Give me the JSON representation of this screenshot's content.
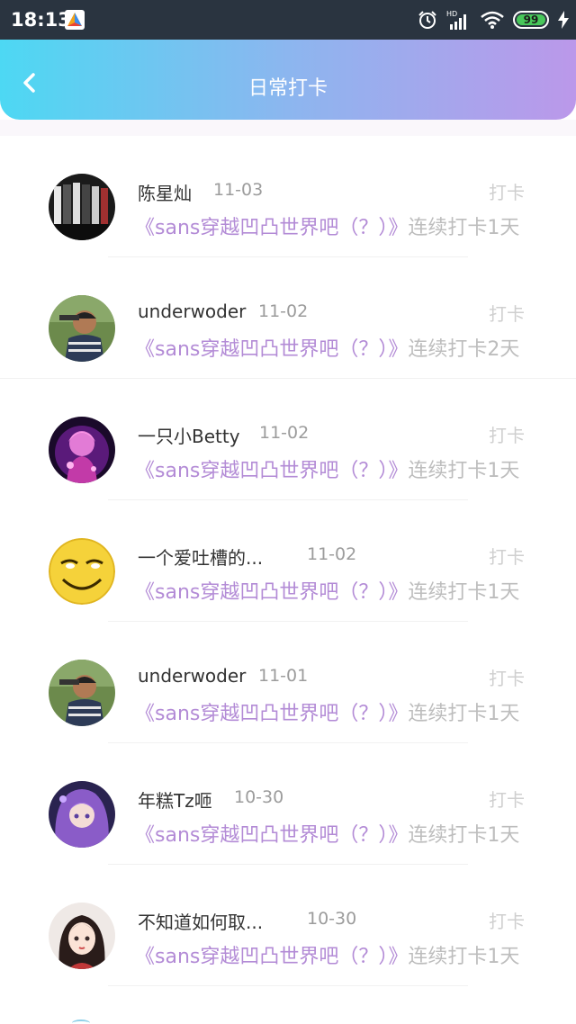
{
  "status_bar": {
    "time": "18:13",
    "network": "HD",
    "battery": "99"
  },
  "header": {
    "title": "日常打卡",
    "back_icon": "chevron-left-icon"
  },
  "colors": {
    "topic": "#b38bd6",
    "header_start": "#4dd8f3",
    "header_end": "#bb98ea"
  },
  "checkins": [
    {
      "name": "陈星灿",
      "date": "11-03",
      "action": "打卡",
      "topic": "《sans穿越凹凸世界吧（？）》",
      "streak": "连续打卡1天"
    },
    {
      "name": "underwoder",
      "date": "11-02",
      "action": "打卡",
      "topic": "《sans穿越凹凸世界吧（？）》",
      "streak": "连续打卡2天"
    },
    {
      "name": "一只小Betty",
      "date": "11-02",
      "action": "打卡",
      "topic": "《sans穿越凹凸世界吧（？）》",
      "streak": "连续打卡1天"
    },
    {
      "name": "一个爱吐槽的...",
      "date": "11-02",
      "action": "打卡",
      "topic": "《sans穿越凹凸世界吧（？）》",
      "streak": "连续打卡1天"
    },
    {
      "name": "underwoder",
      "date": "11-01",
      "action": "打卡",
      "topic": "《sans穿越凹凸世界吧（？）》",
      "streak": "连续打卡1天"
    },
    {
      "name": "年糕Tz咂",
      "date": "10-30",
      "action": "打卡",
      "topic": "《sans穿越凹凸世界吧（？）》",
      "streak": "连续打卡1天"
    },
    {
      "name": "不知道如何取...",
      "date": "10-30",
      "action": "打卡",
      "topic": "《sans穿越凹凸世界吧（？）》",
      "streak": "连续打卡1天"
    }
  ]
}
